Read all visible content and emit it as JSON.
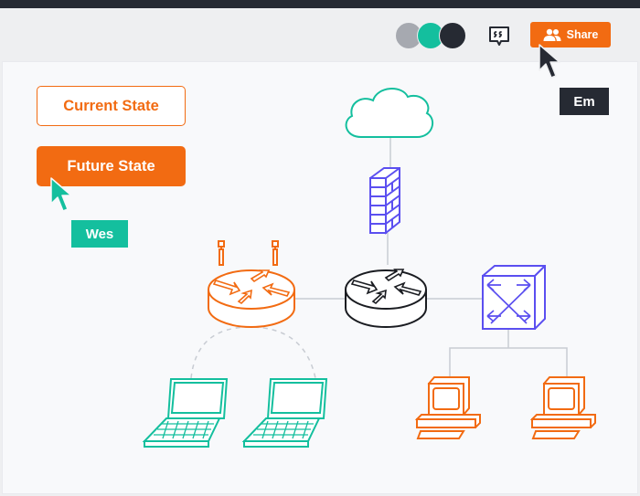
{
  "colors": {
    "topbar": "#262a33",
    "accent_orange": "#f26b12",
    "teal": "#14bf9e",
    "purple": "#5b4ff0",
    "dark": "#262a33",
    "connector": "#c8ccd3",
    "avatar_gray": "#a6a9b0"
  },
  "header": {
    "avatars": [
      {
        "name": "collaborator-gray",
        "color": "#a6a9b0"
      },
      {
        "name": "collaborator-teal",
        "color": "#14bf9e"
      },
      {
        "name": "collaborator-dark",
        "color": "#262a33"
      }
    ],
    "comment_icon": "quote-bubble-icon",
    "share_button": {
      "label": "Share",
      "icon": "users-icon"
    }
  },
  "canvas": {
    "buttons": {
      "current_state": "Current State",
      "future_state": "Future State"
    },
    "collaborators": {
      "wes": "Wes",
      "em": "Em"
    },
    "diagram": {
      "nodes": [
        {
          "id": "cloud",
          "icon": "cloud-icon"
        },
        {
          "id": "firewall",
          "icon": "firewall-icon"
        },
        {
          "id": "core-router",
          "icon": "router-icon"
        },
        {
          "id": "wireless-router",
          "icon": "wireless-router-icon"
        },
        {
          "id": "switch",
          "icon": "switch-icon"
        },
        {
          "id": "laptop-1",
          "icon": "laptop-icon"
        },
        {
          "id": "laptop-2",
          "icon": "laptop-icon"
        },
        {
          "id": "desktop-1",
          "icon": "desktop-computer-icon"
        },
        {
          "id": "desktop-2",
          "icon": "desktop-computer-icon"
        }
      ],
      "edges": [
        {
          "from": "cloud",
          "to": "firewall",
          "style": "solid"
        },
        {
          "from": "firewall",
          "to": "core-router",
          "style": "solid"
        },
        {
          "from": "wireless-router",
          "to": "core-router",
          "style": "solid"
        },
        {
          "from": "core-router",
          "to": "switch",
          "style": "solid"
        },
        {
          "from": "switch",
          "to": "desktop-1",
          "style": "solid"
        },
        {
          "from": "switch",
          "to": "desktop-2",
          "style": "solid"
        },
        {
          "from": "wireless-router",
          "to": "laptop-1",
          "style": "dashed"
        },
        {
          "from": "wireless-router",
          "to": "laptop-2",
          "style": "dashed"
        }
      ]
    }
  }
}
